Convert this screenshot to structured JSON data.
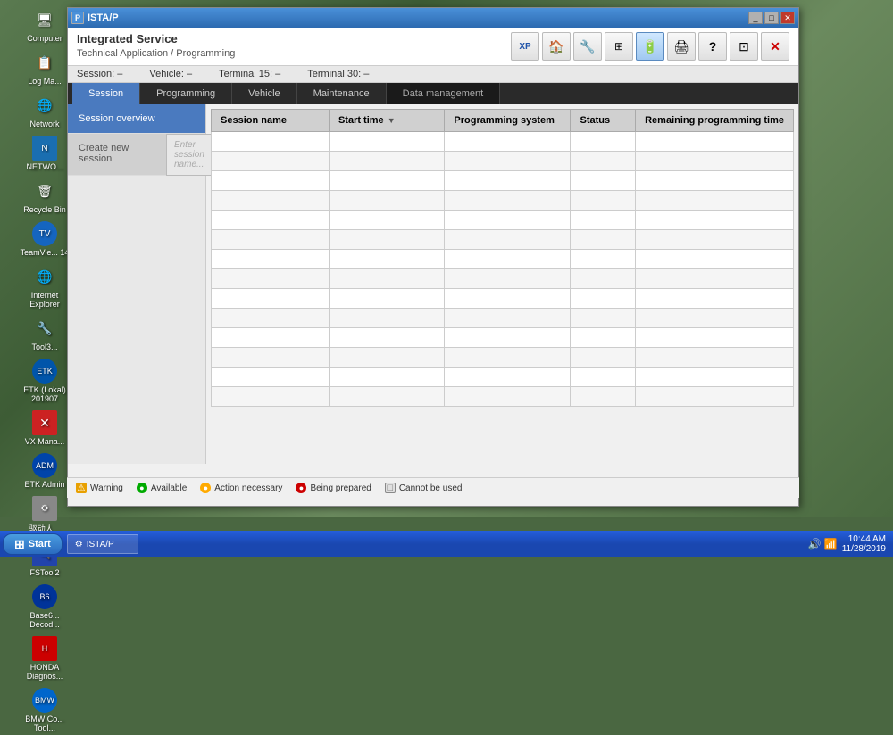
{
  "desktop": {
    "icons": [
      {
        "label": "Computer",
        "icon": "🖥"
      },
      {
        "label": "Log Ma...",
        "icon": "📋"
      },
      {
        "label": "Network",
        "icon": "🌐"
      },
      {
        "label": "NETWO...",
        "icon": "🔌"
      },
      {
        "label": "Recycle Bin",
        "icon": "🗑"
      },
      {
        "label": "TeamVie... 14",
        "icon": "📡"
      },
      {
        "label": "Internet Explorer",
        "icon": "🌐"
      },
      {
        "label": "Tool3...",
        "icon": "🔧"
      },
      {
        "label": "ETK (Lokal) 201907",
        "icon": "⚙"
      },
      {
        "label": "VX Mana...",
        "icon": "✖"
      },
      {
        "label": "ETK Admin",
        "icon": "🔵"
      },
      {
        "label": "驱动人...",
        "icon": "⚙"
      },
      {
        "label": "FSTool2",
        "icon": "🔍"
      },
      {
        "label": "Base6... Decod...",
        "icon": "🔵"
      },
      {
        "label": "HONDA Diagnos...",
        "icon": "📋"
      },
      {
        "label": "BMW Co... Tool...",
        "icon": "🔵"
      }
    ]
  },
  "window": {
    "title": "ISTA/P",
    "app_title": "Integrated Service",
    "app_subtitle": "Technical Application / Programming"
  },
  "status_bar": {
    "session_label": "Session:",
    "session_value": "–",
    "vehicle_label": "Vehicle:",
    "vehicle_value": "–",
    "terminal15_label": "Terminal 15:",
    "terminal15_value": "–",
    "terminal30_label": "Terminal 30:",
    "terminal30_value": "–"
  },
  "nav_tabs": [
    {
      "label": "Session",
      "active": true
    },
    {
      "label": "Programming",
      "active": false
    },
    {
      "label": "Vehicle",
      "active": false
    },
    {
      "label": "Maintenance",
      "active": false
    },
    {
      "label": "Data management",
      "active": false,
      "class": "data-mgmt"
    }
  ],
  "sidebar": {
    "items": [
      {
        "label": "Session overview",
        "active": true
      },
      {
        "label": "Create new session",
        "active": false,
        "secondary": true
      }
    ],
    "session_input_placeholder": "Enter session name..."
  },
  "table": {
    "columns": [
      {
        "label": "Session name",
        "sortable": false
      },
      {
        "label": "Start time",
        "sortable": true
      },
      {
        "label": "Programming system",
        "sortable": false
      },
      {
        "label": "Status",
        "sortable": false
      },
      {
        "label": "Remaining programming time",
        "sortable": false
      }
    ],
    "rows": [
      [
        "",
        "",
        "",
        "",
        ""
      ],
      [
        "",
        "",
        "",
        "",
        ""
      ],
      [
        "",
        "",
        "",
        "",
        ""
      ],
      [
        "",
        "",
        "",
        "",
        ""
      ],
      [
        "",
        "",
        "",
        "",
        ""
      ],
      [
        "",
        "",
        "",
        "",
        ""
      ],
      [
        "",
        "",
        "",
        "",
        ""
      ],
      [
        "",
        "",
        "",
        "",
        ""
      ],
      [
        "",
        "",
        "",
        "",
        ""
      ],
      [
        "",
        "",
        "",
        "",
        ""
      ],
      [
        "",
        "",
        "",
        "",
        ""
      ],
      [
        "",
        "",
        "",
        "",
        ""
      ],
      [
        "",
        "",
        "",
        "",
        ""
      ],
      [
        "",
        "",
        "",
        "",
        ""
      ]
    ]
  },
  "legend": [
    {
      "label": "Warning",
      "color": "#e8a000",
      "symbol": "⚠"
    },
    {
      "label": "Available",
      "color": "#00aa00",
      "symbol": "●"
    },
    {
      "label": "Action necessary",
      "color": "#ffaa00",
      "symbol": "●"
    },
    {
      "label": "Being prepared",
      "color": "#cc0000",
      "symbol": "●"
    },
    {
      "label": "Cannot be used",
      "color": "#888888",
      "symbol": "☐"
    }
  ],
  "toolbar": {
    "buttons": [
      {
        "label": "XP",
        "title": "xp-button"
      },
      {
        "label": "🏠",
        "title": "home-button"
      },
      {
        "label": "🔧",
        "title": "settings-button"
      },
      {
        "label": "⊞",
        "title": "layout-button"
      },
      {
        "label": "🔋",
        "title": "battery-button",
        "active": true
      },
      {
        "label": "🖨",
        "title": "print-button"
      },
      {
        "label": "?",
        "title": "help-button"
      },
      {
        "label": "⊡",
        "title": "display-button"
      },
      {
        "label": "✕",
        "title": "close-button"
      }
    ]
  },
  "taskbar": {
    "start_label": "Start",
    "items": [
      {
        "label": "ISTA/P",
        "icon": "⚙"
      }
    ],
    "time": "10:44 AM",
    "date": "11/28/2019"
  }
}
